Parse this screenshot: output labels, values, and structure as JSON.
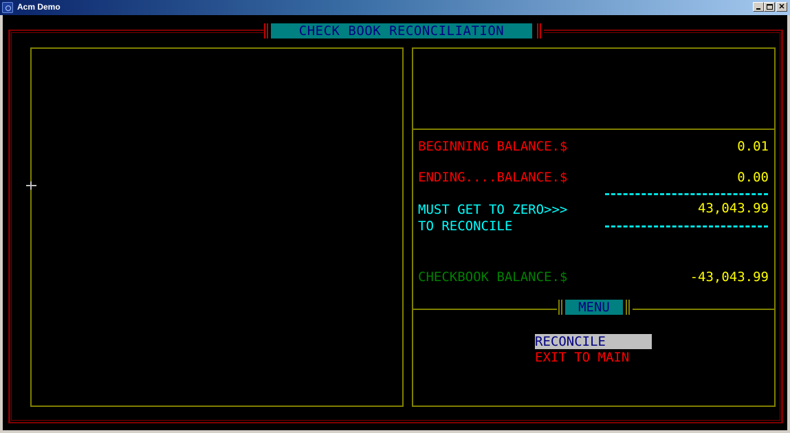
{
  "window": {
    "title": "Acm Demo",
    "controls": [
      "minimize",
      "maximize",
      "close"
    ]
  },
  "screen": {
    "title": "CHECK BOOK RECONCILIATION"
  },
  "balances": {
    "beginning_label": "BEGINNING BALANCE.$",
    "beginning_value": "0.01",
    "ending_label": "ENDING....BALANCE.$",
    "ending_value": "0.00",
    "must_get_label": "MUST GET TO ZERO>>>",
    "must_get_value": "43,043.99",
    "to_reconcile_label": "TO RECONCILE",
    "checkbook_label": "CHECKBOOK BALANCE.$",
    "checkbook_value": "-43,043.99"
  },
  "menu": {
    "title": "MENU",
    "items": [
      {
        "label": "RECONCILE",
        "selected": true
      },
      {
        "label": "EXIT TO MAIN",
        "selected": false
      }
    ]
  },
  "colors": {
    "frame": "#800000",
    "panel_border": "#808000",
    "label_red": "#ff0000",
    "value_yellow": "#ffff00",
    "label_cyan": "#00ffff",
    "label_green": "#008000",
    "tab_background": "#008080",
    "tab_text": "#000080"
  }
}
